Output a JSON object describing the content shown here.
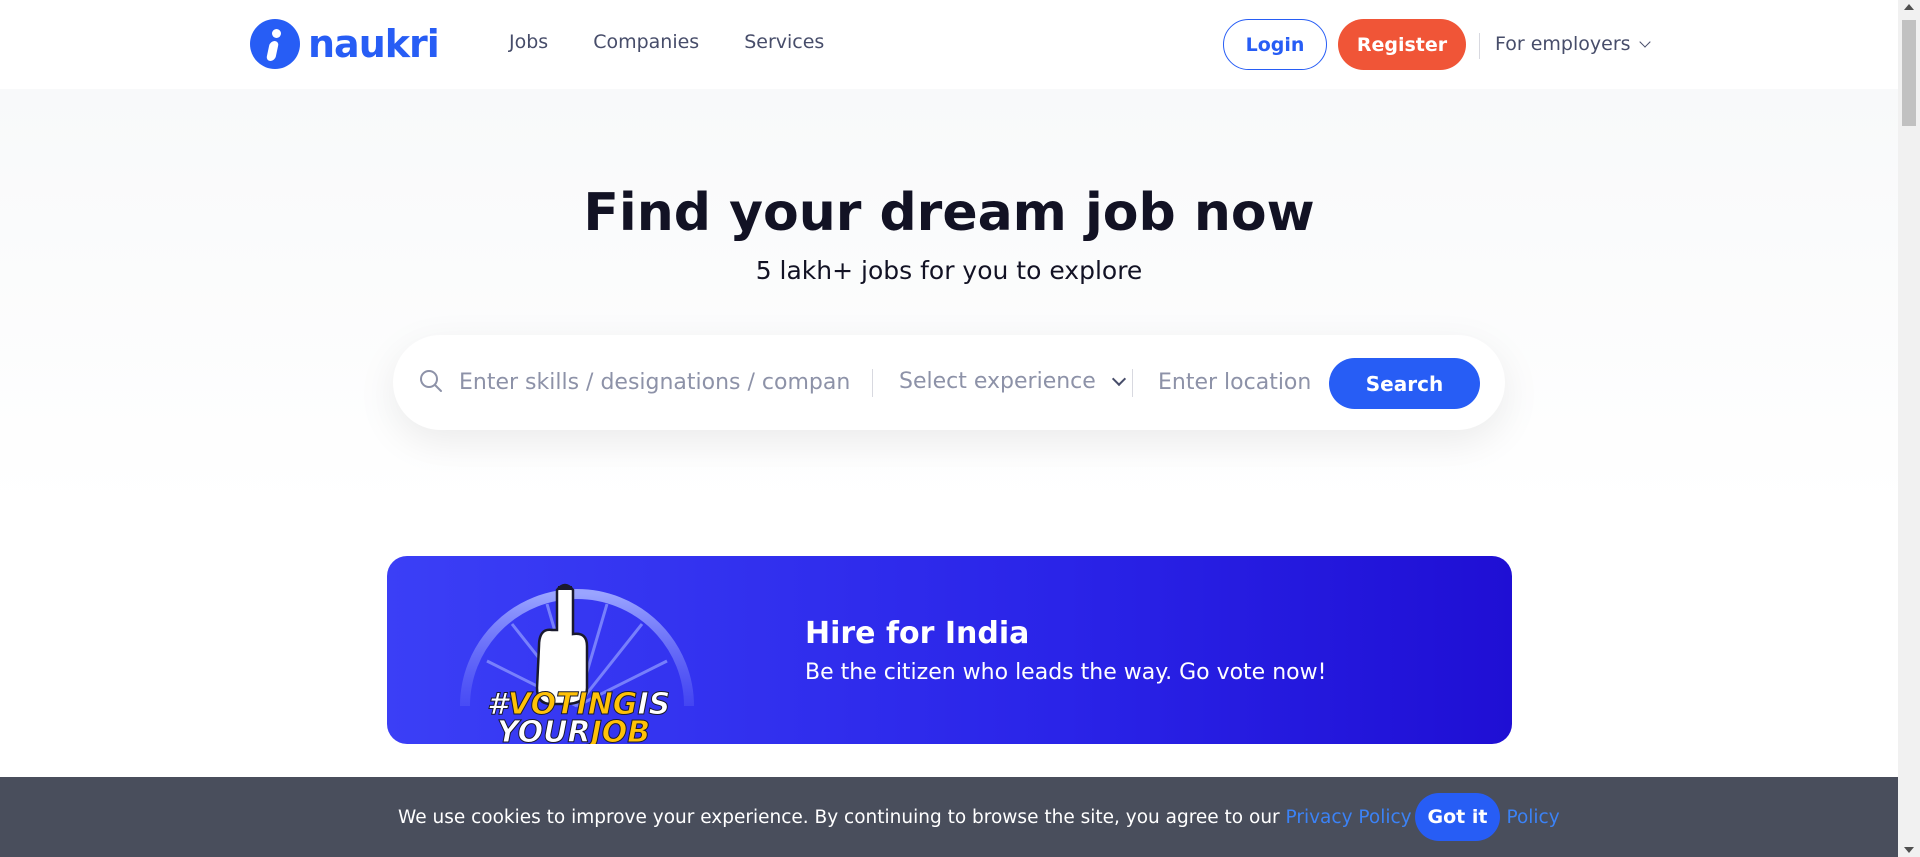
{
  "header": {
    "logo_text": "naukri",
    "nav": [
      "Jobs",
      "Companies",
      "Services"
    ],
    "login_label": "Login",
    "register_label": "Register",
    "employers_label": "For employers"
  },
  "hero": {
    "title": "Find your dream job now",
    "subtitle": "5 lakh+ jobs for you to explore"
  },
  "search": {
    "skills_placeholder": "Enter skills / designations / companies",
    "experience_label": "Select experience",
    "location_placeholder": "Enter location",
    "button_label": "Search"
  },
  "banner": {
    "art_line1_a": "#",
    "art_line1_b": "VOTING",
    "art_line1_c": "IS",
    "art_line2_a": "YOUR",
    "art_line2_b": "JOB",
    "title": "Hire for India",
    "subtitle": "Be the citizen who leads the way. Go vote now!"
  },
  "cookie": {
    "text": "We use cookies to improve your experience. By continuing to browse the site, you agree to our ",
    "privacy_link": "Privacy Policy",
    "and": " & ",
    "cookie_link": "Cookie Policy",
    "button_label": "Got it"
  },
  "colors": {
    "brand_blue": "#275df5",
    "register_orange": "#f05537",
    "banner_blue": "#2a24e8",
    "cookie_bg": "#494e5c"
  }
}
